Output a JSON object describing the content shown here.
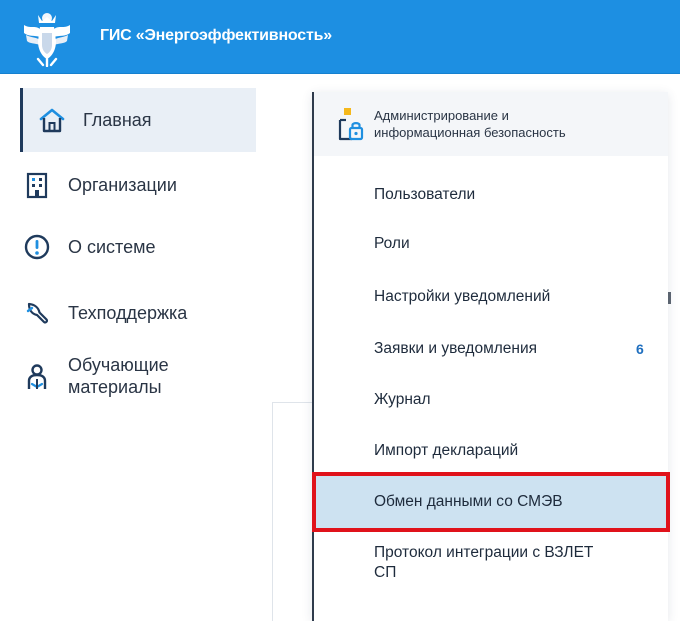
{
  "header": {
    "title": "ГИС «Энергоэффективность»",
    "bg_color": "#1d8fe2",
    "logo_icon": "coat-of-arms-icon"
  },
  "sidebar": {
    "items": [
      {
        "label": "Главная",
        "icon": "home-icon",
        "active": true
      },
      {
        "label": "Организации",
        "icon": "building-icon"
      },
      {
        "label": "О системе",
        "icon": "info-icon"
      },
      {
        "label": "Техподдержка",
        "icon": "support-icon"
      },
      {
        "label": "Обучающие материалы",
        "label_line1": "Обучающие",
        "label_line2": "материалы",
        "icon": "education-icon"
      }
    ]
  },
  "dropdown": {
    "section_title_line1": "Администрирование и",
    "section_title_line2": "информационная безопасность",
    "section_icon": "admin-security-icon",
    "items": [
      {
        "label": "Пользователи"
      },
      {
        "label": "Роли"
      },
      {
        "label": "Настройки уведомлений"
      },
      {
        "label": "Заявки и уведомления",
        "badge": "6"
      },
      {
        "label": "Журнал"
      },
      {
        "label": "Импорт деклараций"
      },
      {
        "label": "Обмен данными со СМЭВ",
        "highlighted": true
      },
      {
        "label_line1": "Протокол интеграции с ВЗЛЕТ",
        "label_line2": "СП"
      }
    ],
    "highlight_color": "#cde2f1",
    "highlight_border_color": "#e0121b",
    "badge_color": "#1f6fbf"
  }
}
